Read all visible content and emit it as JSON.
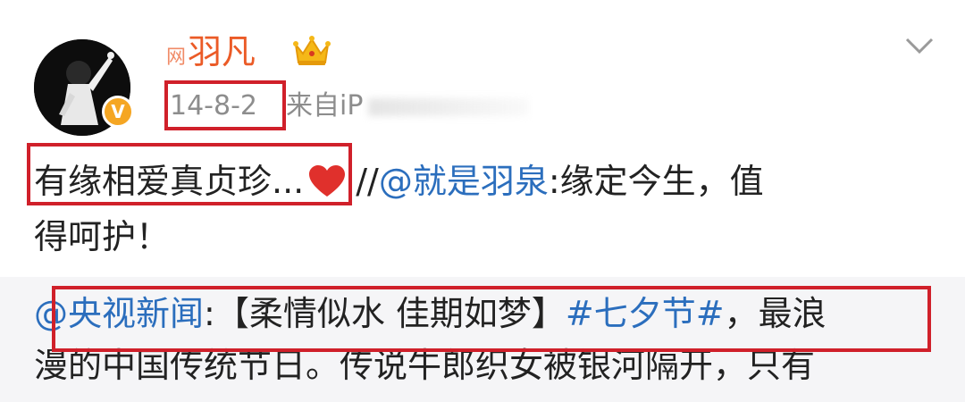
{
  "user": {
    "name_prefix": "网",
    "name": "羽凡",
    "avatar_icon": "avatar-photo",
    "verified_icon": "v-badge",
    "verified_label": "V",
    "crown_icon": "crown-icon"
  },
  "meta": {
    "date": "14-8-2",
    "source_prefix": "来自iP"
  },
  "post": {
    "text_before": "有缘相爱真贞珍...",
    "heart_icon": "heart-icon",
    "separator": "//",
    "mention": "@就是羽泉",
    "text_after_line1": ":缘定今生，值",
    "text_line2": "得呵护！"
  },
  "repost": {
    "mention": "@央视新闻",
    "text_a": ":【柔情似水 佳期如梦】",
    "topic": "#七夕节#",
    "text_b": "，最浪",
    "text_line2": "漫的中国传统节日。传说牛郎织女被银河隔开，只有"
  },
  "colors": {
    "username": "#eb5b27",
    "meta": "#8d8d8d",
    "link": "#2b6ebd",
    "highlight": "#d0202a",
    "heart": "#e0302c",
    "repost_bg": "#f5f5f7"
  }
}
